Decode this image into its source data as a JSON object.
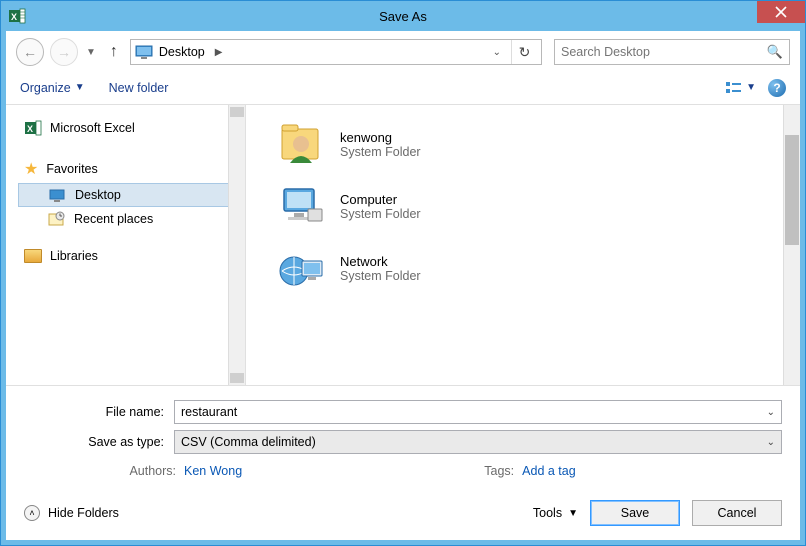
{
  "window": {
    "title": "Save As"
  },
  "nav": {
    "path_location": "Desktop",
    "search_placeholder": "Search Desktop"
  },
  "toolbar": {
    "organize": "Organize",
    "new_folder": "New folder"
  },
  "navpane": {
    "excel": "Microsoft Excel",
    "favorites": "Favorites",
    "desktop": "Desktop",
    "recent": "Recent places",
    "libraries": "Libraries"
  },
  "files": [
    {
      "name": "kenwong",
      "type": "System Folder",
      "icon": "user"
    },
    {
      "name": "Computer",
      "type": "System Folder",
      "icon": "computer"
    },
    {
      "name": "Network",
      "type": "System Folder",
      "icon": "network"
    }
  ],
  "form": {
    "filename_label": "File name:",
    "filename_value": "restaurant",
    "type_label": "Save as type:",
    "type_value": "CSV (Comma delimited)",
    "authors_label": "Authors:",
    "authors_value": "Ken Wong",
    "tags_label": "Tags:",
    "tags_value": "Add a tag"
  },
  "footer": {
    "hide_folders": "Hide Folders",
    "tools": "Tools",
    "save": "Save",
    "cancel": "Cancel"
  }
}
